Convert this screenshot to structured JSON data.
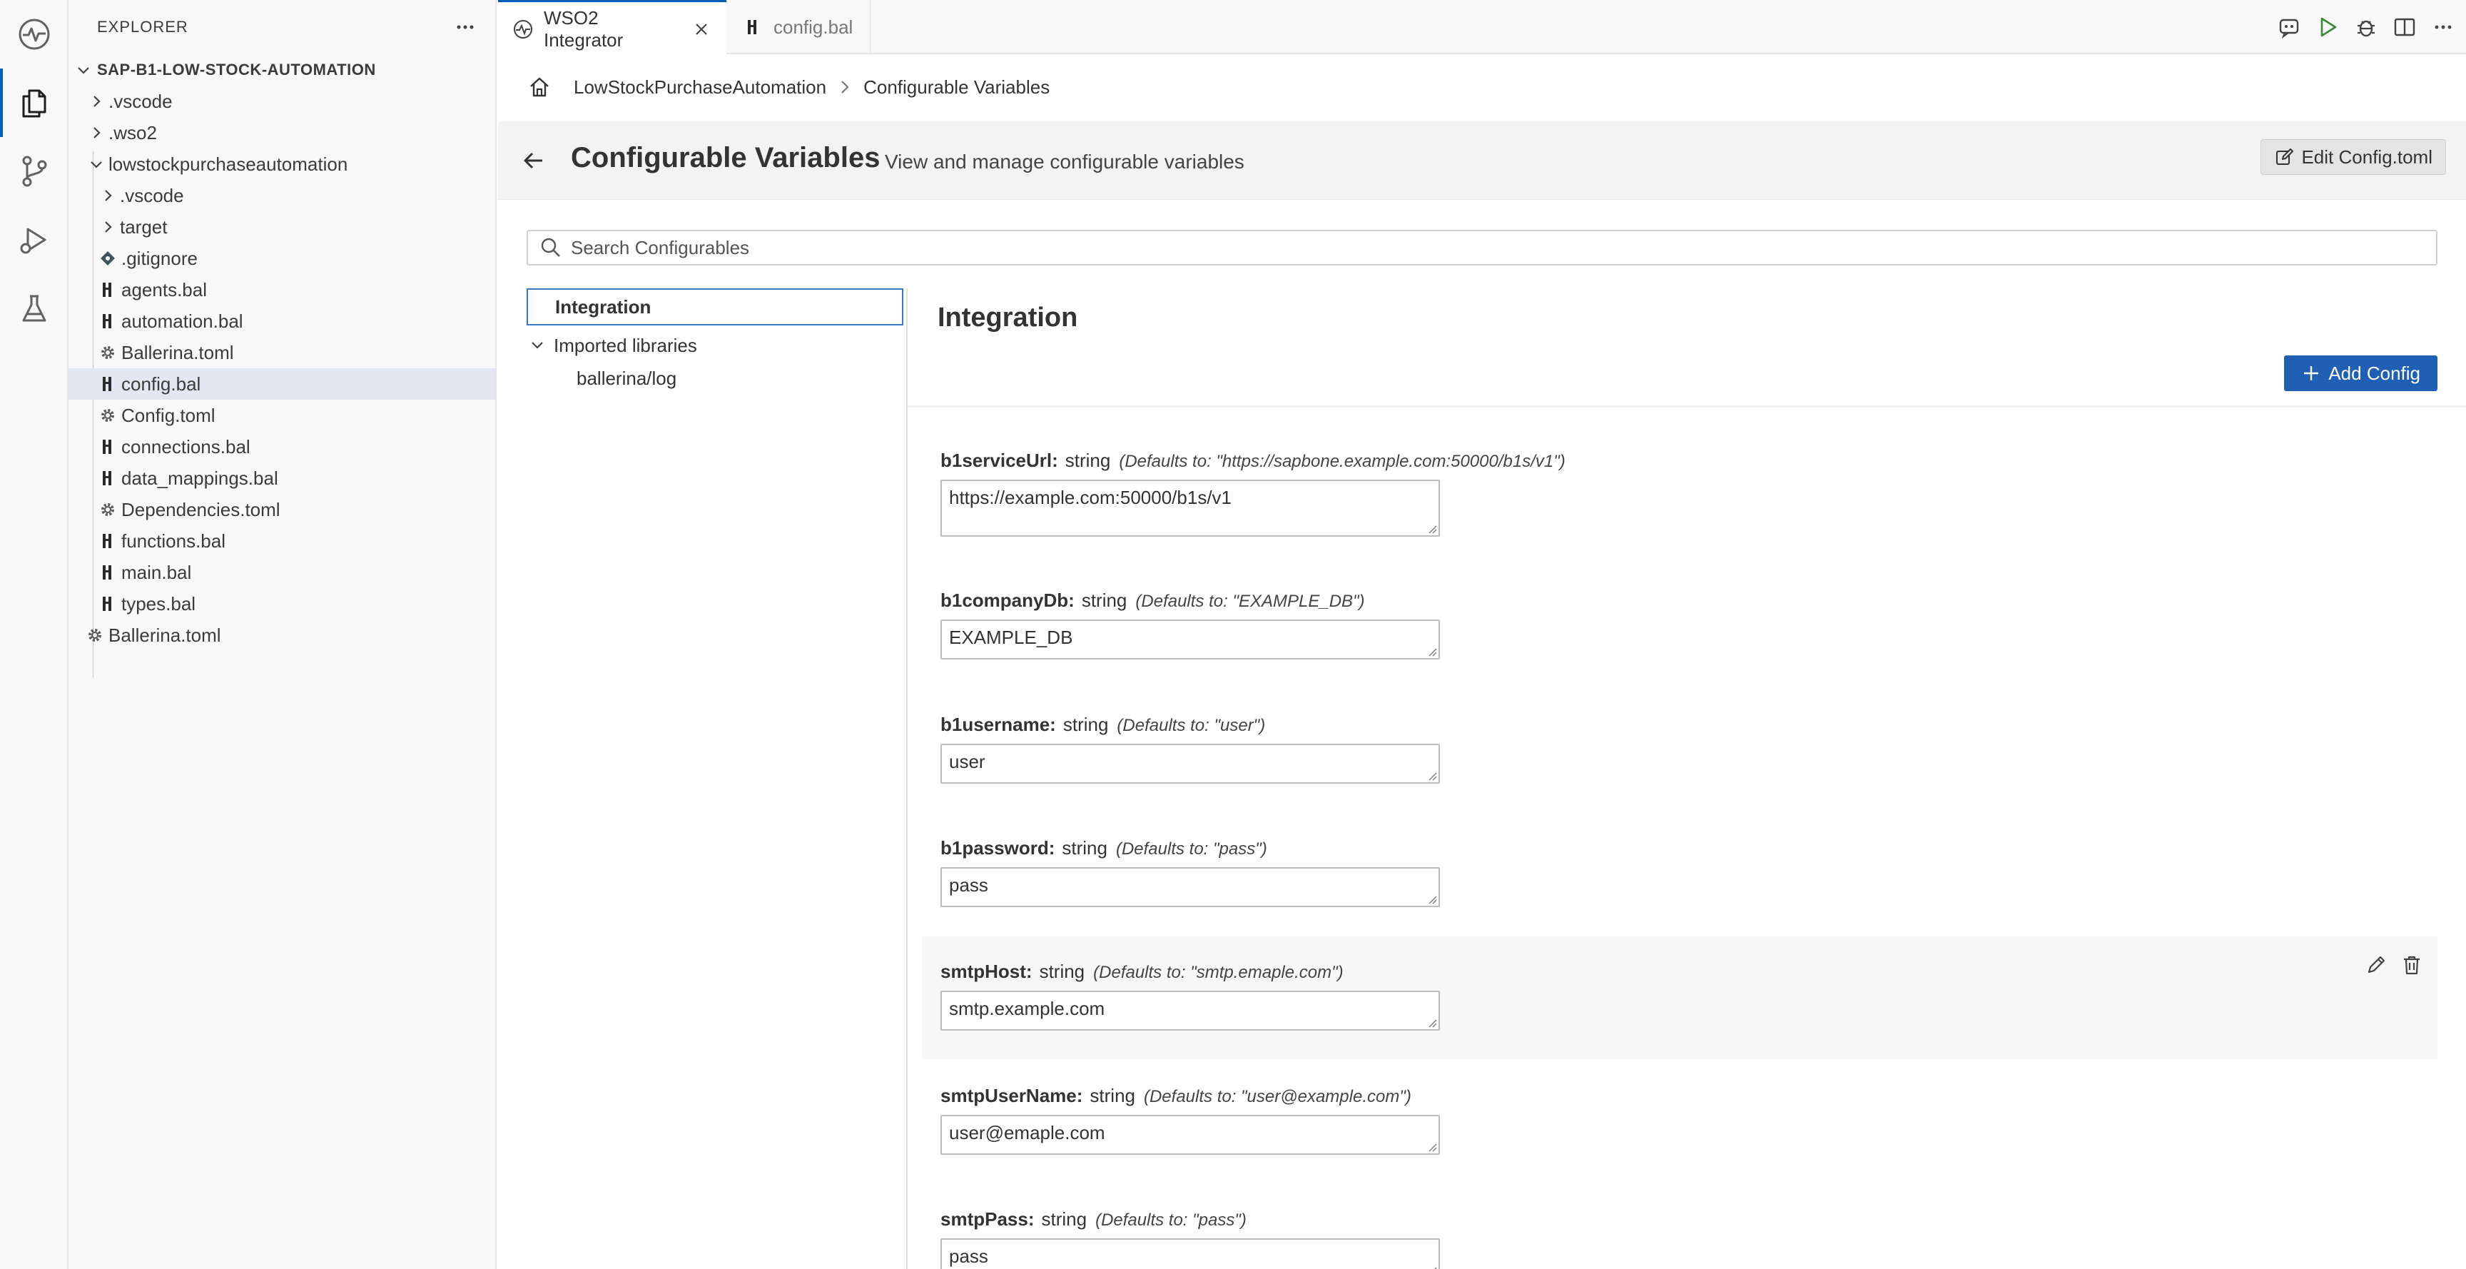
{
  "sidebar": {
    "header": "EXPLORER",
    "items": [
      {
        "label": "SAP-B1-LOW-STOCK-AUTOMATION",
        "kind": "root"
      },
      {
        "label": ".vscode",
        "kind": "folder"
      },
      {
        "label": ".wso2",
        "kind": "folder"
      },
      {
        "label": "lowstockpurchaseautomation",
        "kind": "folder-open"
      },
      {
        "label": ".vscode",
        "kind": "folder"
      },
      {
        "label": "target",
        "kind": "folder"
      },
      {
        "label": ".gitignore",
        "kind": "git"
      },
      {
        "label": "agents.bal",
        "kind": "bal"
      },
      {
        "label": "automation.bal",
        "kind": "bal"
      },
      {
        "label": "Ballerina.toml",
        "kind": "toml"
      },
      {
        "label": "config.bal",
        "kind": "bal"
      },
      {
        "label": "Config.toml",
        "kind": "toml"
      },
      {
        "label": "connections.bal",
        "kind": "bal"
      },
      {
        "label": "data_mappings.bal",
        "kind": "bal"
      },
      {
        "label": "Dependencies.toml",
        "kind": "toml"
      },
      {
        "label": "functions.bal",
        "kind": "bal"
      },
      {
        "label": "main.bal",
        "kind": "bal"
      },
      {
        "label": "types.bal",
        "kind": "bal"
      },
      {
        "label": "Ballerina.toml",
        "kind": "toml"
      }
    ]
  },
  "tabs": [
    {
      "label": "WSO2 Integrator",
      "active": true
    },
    {
      "label": "config.bal",
      "active": false
    }
  ],
  "breadcrumb": {
    "project": "LowStockPurchaseAutomation",
    "current": "Configurable Variables"
  },
  "header": {
    "title": "Configurable Variables",
    "subtitle": "View and manage configurable variables",
    "edit_button": "Edit Config.toml"
  },
  "search": {
    "placeholder": "Search Configurables"
  },
  "categories": {
    "selected": "Integration",
    "group": "Imported libraries",
    "subitems": [
      "ballerina/log"
    ]
  },
  "panel": {
    "title": "Integration",
    "add_button": "Add Config"
  },
  "configs": [
    {
      "name": "b1serviceUrl:",
      "type": "string",
      "default": "(Defaults to: \"https://sapbone.example.com:50000/b1s/v1\")",
      "value": "https://example.com:50000/b1s/v1"
    },
    {
      "name": "b1companyDb:",
      "type": "string",
      "default": "(Defaults to: \"EXAMPLE_DB\")",
      "value": "EXAMPLE_DB"
    },
    {
      "name": "b1username:",
      "type": "string",
      "default": "(Defaults to: \"user\")",
      "value": "user"
    },
    {
      "name": "b1password:",
      "type": "string",
      "default": "(Defaults to: \"pass\")",
      "value": "pass"
    },
    {
      "name": "smtpHost:",
      "type": "string",
      "default": "(Defaults to: \"smtp.emaple.com\")",
      "value": "smtp.example.com"
    },
    {
      "name": "smtpUserName:",
      "type": "string",
      "default": "(Defaults to: \"user@example.com\")",
      "value": "user@emaple.com"
    },
    {
      "name": "smtpPass:",
      "type": "string",
      "default": "(Defaults to: \"pass\")",
      "value": "pass"
    }
  ],
  "colors": {
    "accent": "#005fb8",
    "primary_button": "#1f5fb4",
    "selection": "#e4e6f1"
  }
}
